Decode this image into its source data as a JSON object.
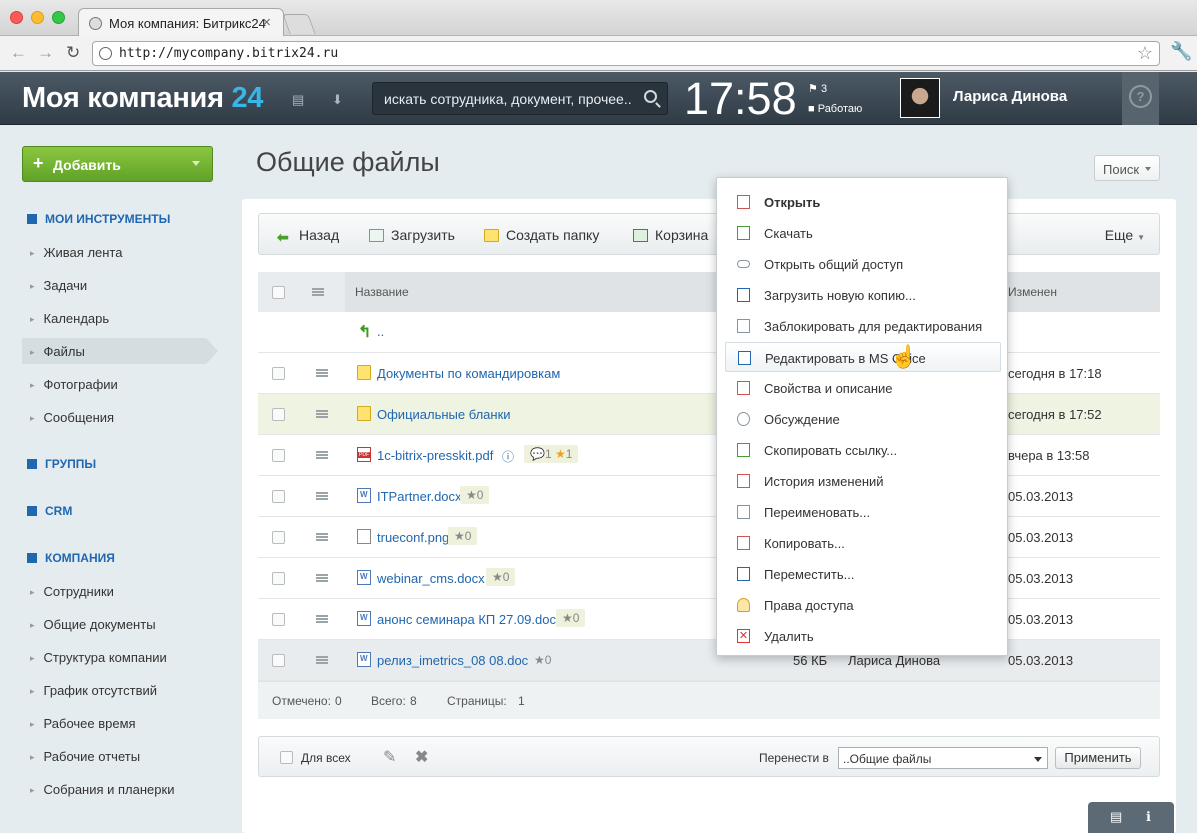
{
  "browser": {
    "tab_title": "Моя компания: Битрикс24",
    "url": "http://mycompany.bitrix24.ru"
  },
  "header": {
    "logo_text": "Моя компания",
    "logo_num": "24",
    "search_placeholder": "искать сотрудника, документ, прочее..",
    "clock": "17:58",
    "tasks_count": "3",
    "status": "Работаю",
    "user_name": "Лариса Динова",
    "help": "?"
  },
  "sidebar": {
    "add_label": "Добавить",
    "sections": {
      "tools": "МОИ ИНСТРУМЕНТЫ",
      "groups": "ГРУППЫ",
      "crm": "CRM",
      "company": "КОМПАНИЯ"
    },
    "tools_items": [
      "Живая лента",
      "Задачи",
      "Календарь",
      "Файлы",
      "Фотографии",
      "Сообщения"
    ],
    "company_items": [
      "Сотрудники",
      "Общие документы",
      "Структура компании",
      "График отсутствий",
      "Рабочее время",
      "Рабочие отчеты",
      "Собрания и планерки"
    ]
  },
  "main": {
    "title": "Общие файлы",
    "search_btn": "Поиск",
    "actions": {
      "back": "Назад",
      "upload": "Загрузить",
      "new_folder": "Создать папку",
      "trash": "Корзина",
      "more": "Еще"
    },
    "columns": {
      "name": "Название",
      "changed": "Изменен"
    },
    "up_link": "..",
    "rows": [
      {
        "name": "Документы по командировкам",
        "changed": "сегодня в 17:18"
      },
      {
        "name": "Официальные бланки",
        "changed": "сегодня в 17:52"
      },
      {
        "name": "1c-bitrix-presskit.pdf",
        "comments": "1",
        "rating": "1",
        "changed": "вчера в 13:58"
      },
      {
        "name": "ITPartner.docx",
        "rating": "0",
        "changed": "05.03.2013"
      },
      {
        "name": "trueconf.png",
        "rating": "0",
        "changed": "05.03.2013"
      },
      {
        "name": "webinar_cms.docx",
        "rating": "0",
        "changed": "05.03.2013"
      },
      {
        "name": "анонс семинара КП 27.09.doc",
        "rating": "0",
        "changed": "05.03.2013"
      },
      {
        "name": "релиз_imetrics_08 08.doc",
        "rating": "0",
        "size": "56 КБ",
        "author": "Лариса Динова",
        "changed": "05.03.2013"
      }
    ],
    "footer": {
      "checked_label": "Отмечено:",
      "checked": "0",
      "total_label": "Всего:",
      "total": "8",
      "pages_label": "Страницы:",
      "pages": "1"
    },
    "bottom": {
      "for_all": "Для всех",
      "move_to": "Перенести в",
      "move_value": "..Общие файлы",
      "apply": "Применить"
    }
  },
  "context_menu": [
    "Открыть",
    "Скачать",
    "Открыть общий доступ",
    "Загрузить новую копию...",
    "Заблокировать для редактирования",
    "Редактировать в MS Office",
    "Свойства и описание",
    "Обсуждение",
    "Скопировать ссылку...",
    "История изменений",
    "Переименовать...",
    "Копировать...",
    "Переместить...",
    "Права доступа",
    "Удалить"
  ],
  "colors": {
    "accent": "#2067b0",
    "logo_num": "#38b6e8",
    "add_button": "#6eb22f"
  }
}
